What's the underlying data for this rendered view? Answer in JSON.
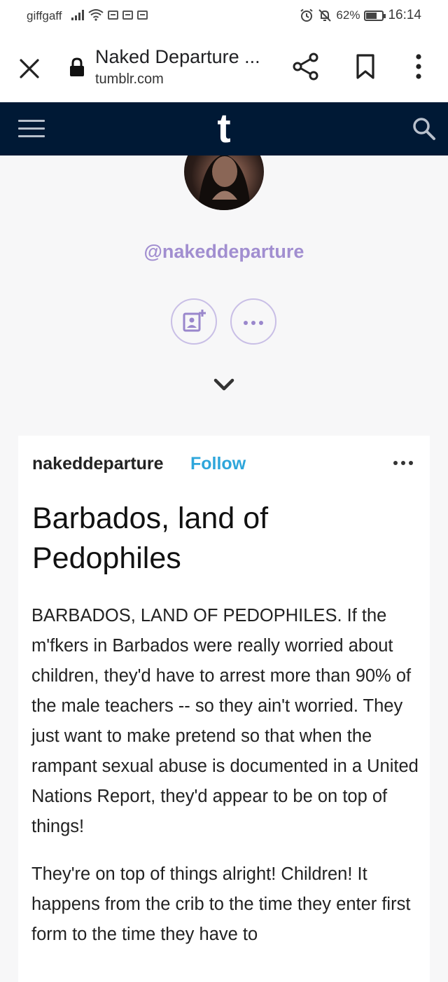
{
  "status_bar": {
    "carrier": "giffgaff",
    "battery": "62%",
    "time": "16:14"
  },
  "browser": {
    "page_title": "Naked Departure ...",
    "domain": "tumblr.com"
  },
  "tumblr": {
    "logo": "t"
  },
  "profile": {
    "handle": "@nakeddeparture"
  },
  "post": {
    "author": "nakeddeparture",
    "follow_label": "Follow",
    "title": "Barbados, land of Pedophiles",
    "paragraphs": [
      "BARBADOS, LAND OF PEDOPHILES. If the m'fkers in Barbados were really worried about children, they'd have to arrest more than 90% of the male teachers -- so they ain't worried. They just want to make pretend so that when the rampant sexual abuse is documented in a United Nations Report, they'd appear to be on top of things!",
      "They're on top of things alright! Children! It happens from the crib to the time they enter first form to the time they have to"
    ]
  },
  "colors": {
    "tumblr_navy": "#001935",
    "handle_purple": "#a18ed0",
    "follow_blue": "#2ea6db"
  },
  "icons": [
    "close-icon",
    "lock-icon",
    "share-icon",
    "bookmark-icon",
    "more-vertical-icon",
    "menu-icon",
    "search-icon",
    "follow-blog-icon",
    "more-horizontal-icon",
    "chevron-down-icon",
    "alarm-icon",
    "mute-icon",
    "wifi-icon",
    "signal-icon",
    "battery-icon"
  ]
}
